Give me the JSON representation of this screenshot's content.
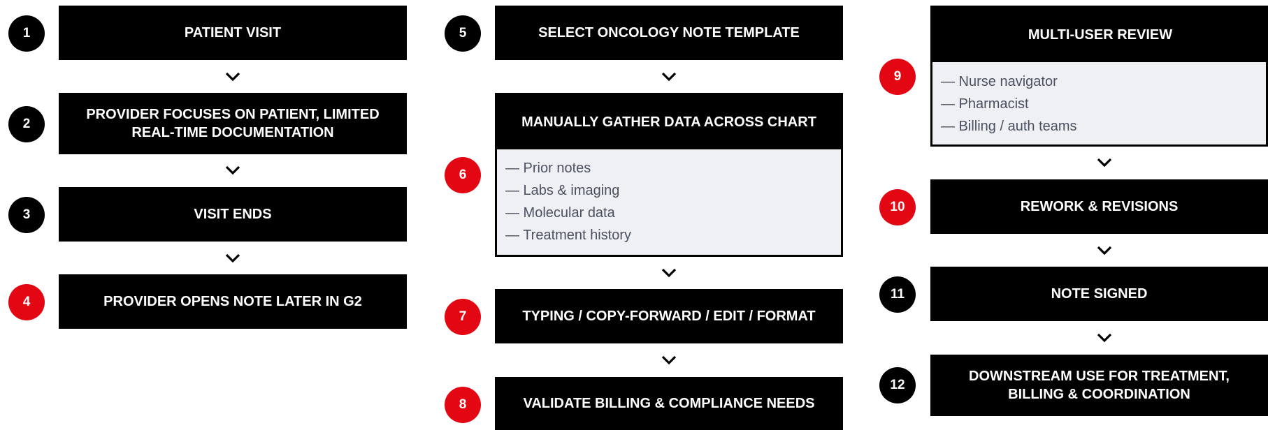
{
  "steps": [
    {
      "number": "1",
      "label": "PATIENT VISIT",
      "highlight": false
    },
    {
      "number": "2",
      "label_lines": [
        "PROVIDER FOCUSES ON PATIENT, LIMITED",
        "REAL-TIME DOCUMENTATION"
      ],
      "highlight": false
    },
    {
      "number": "3",
      "label": "VISIT ENDS",
      "highlight": false
    },
    {
      "number": "4",
      "label": "PROVIDER OPENS NOTE LATER IN G2",
      "highlight": true
    },
    {
      "number": "5",
      "label": "SELECT ONCOLOGY NOTE TEMPLATE",
      "highlight": false
    },
    {
      "number": "6",
      "label": "MANUALLY GATHER DATA ACROSS CHART",
      "items": [
        "— Prior notes",
        "— Labs & imaging",
        "— Molecular data",
        "— Treatment history"
      ],
      "highlight": true
    },
    {
      "number": "7",
      "label": "TYPING / COPY-FORWARD / EDIT / FORMAT",
      "highlight": true
    },
    {
      "number": "8",
      "label": "VALIDATE BILLING & COMPLIANCE NEEDS",
      "highlight": true
    },
    {
      "number": "9",
      "label": "MULTI-USER REVIEW",
      "items": [
        "— Nurse navigator",
        "— Pharmacist",
        "— Billing / auth teams"
      ],
      "highlight": true
    },
    {
      "number": "10",
      "label": "REWORK & REVISIONS",
      "highlight": true
    },
    {
      "number": "11",
      "label": "NOTE SIGNED",
      "highlight": false
    },
    {
      "number": "12",
      "label_lines": [
        "DOWNSTREAM USE FOR TREATMENT,",
        "BILLING & COORDINATION"
      ],
      "highlight": false
    }
  ],
  "colors": {
    "highlight": "#e30613",
    "default": "#000000",
    "panel": "#eef0f4",
    "item_text": "#4a5060"
  },
  "icons": {
    "arrow": "chevron-down-icon"
  }
}
